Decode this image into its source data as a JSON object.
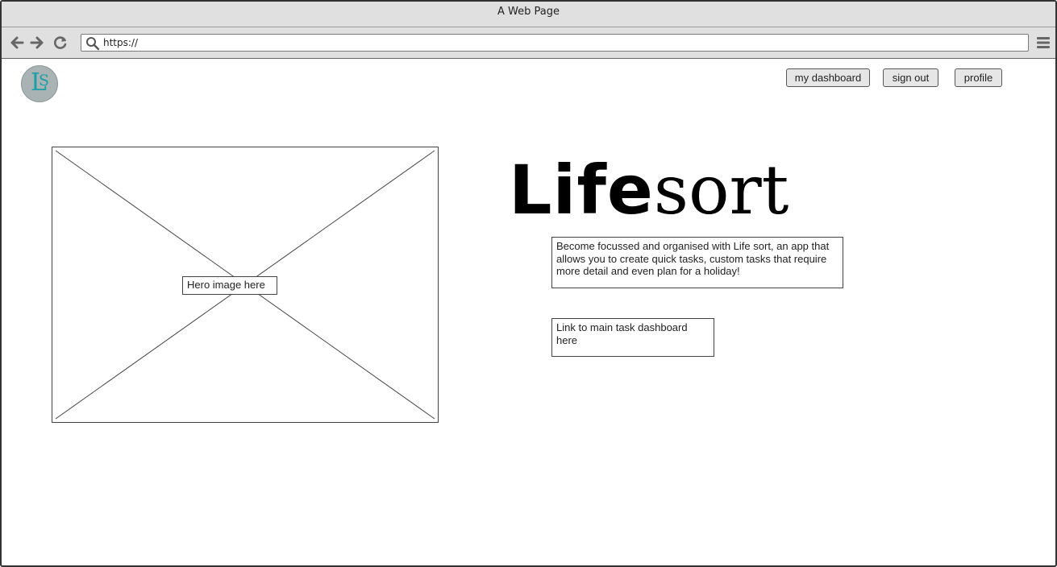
{
  "window": {
    "title": "A Web Page"
  },
  "toolbar": {
    "back_icon": "arrow-left-icon",
    "forward_icon": "arrow-right-icon",
    "reload_icon": "reload-icon",
    "url": "https://",
    "search_icon": "search-icon",
    "menu_icon": "hamburger-menu-icon"
  },
  "header": {
    "logo_letters": [
      "L",
      "S"
    ],
    "logo_colors": {
      "background": "#a9b3b4",
      "letters": "#1ba0a8"
    },
    "nav_buttons": [
      {
        "label": "my dashboard"
      },
      {
        "label": "sign out"
      },
      {
        "label": "profile"
      }
    ]
  },
  "hero": {
    "placeholder_label": "Hero image here"
  },
  "main": {
    "brand_title_part1": "Life",
    "brand_title_part2": "sort",
    "description": "Become focussed and organised with Life sort, an app that allows you to create quick tasks, custom tasks that require more detail and even plan for a holiday!",
    "dashboard_link": "Link to main task dashboard here"
  }
}
